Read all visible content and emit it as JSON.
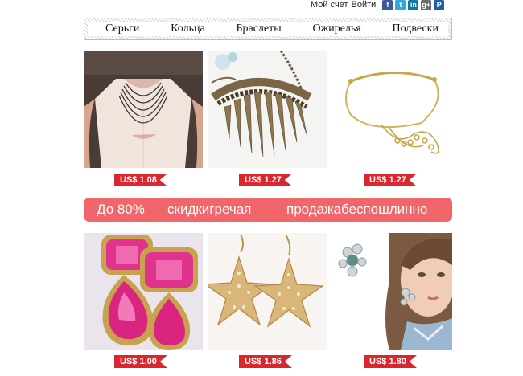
{
  "top_links": {
    "account": "Мой счет",
    "login": "Войти"
  },
  "social": [
    {
      "icon": "facebook-icon",
      "glyph": "f",
      "color": "#3b5998"
    },
    {
      "icon": "twitter-icon",
      "glyph": "t",
      "color": "#2fa9e0"
    },
    {
      "icon": "linkedin-icon",
      "glyph": "in",
      "color": "#0e76a8"
    },
    {
      "icon": "googleplus-icon",
      "glyph": "g+",
      "color": "#6d6d6d"
    },
    {
      "icon": "paypal-icon",
      "glyph": "P",
      "color": "#1f5faa"
    }
  ],
  "nav": [
    "Серьги",
    "Кольца",
    "Браслеты",
    "Ожирелья",
    "Подвески"
  ],
  "banner": {
    "part1": "До 80%",
    "part2": "скидкигречая",
    "part3": "продажабеспошлинно"
  },
  "products_row1": [
    {
      "image": "body-chain-blouse",
      "price": "US$ 1.08"
    },
    {
      "image": "spike-bib-necklace",
      "price": "US$ 1.27"
    },
    {
      "image": "gold-collar-chain",
      "price": "US$ 1.27"
    }
  ],
  "products_row2": [
    {
      "image": "pink-gem-earrings",
      "price": "US$ 1.00"
    },
    {
      "image": "starfish-earrings",
      "price": "US$ 1.86"
    },
    {
      "image": "crystal-cluster-earrings-model",
      "price": "US$ 1.80"
    }
  ],
  "colors": {
    "price_tag": "#d9272d",
    "banner": "#f0666a"
  }
}
